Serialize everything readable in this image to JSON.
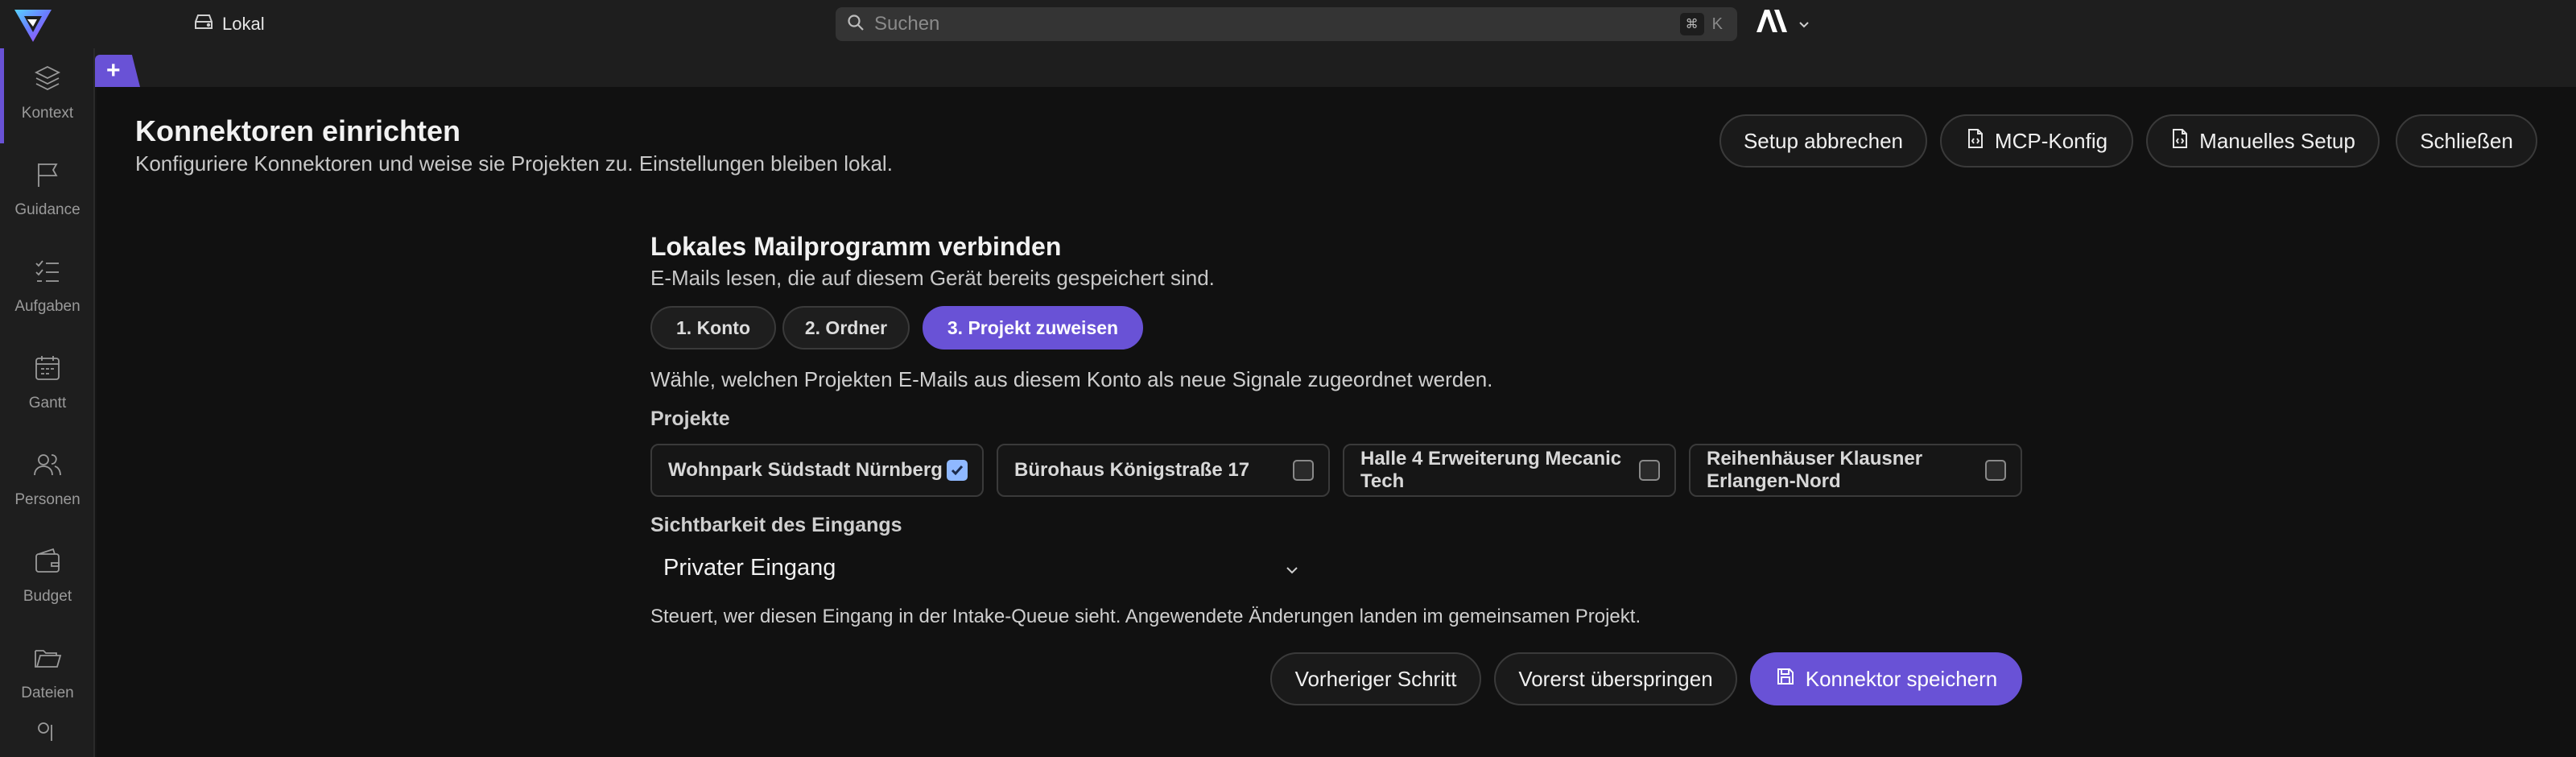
{
  "topbar": {
    "location_label": "Lokal",
    "search_placeholder": "Suchen",
    "shortcut_modifier": "⌘",
    "shortcut_key": "K",
    "brand_mark": "AI"
  },
  "tabs": {
    "add_label": "+"
  },
  "sidebar": {
    "items": [
      {
        "label": "Kontext",
        "icon": "layers-icon"
      },
      {
        "label": "Guidance",
        "icon": "flag-icon"
      },
      {
        "label": "Aufgaben",
        "icon": "checklist-icon"
      },
      {
        "label": "Gantt",
        "icon": "calendar-icon"
      },
      {
        "label": "Personen",
        "icon": "people-icon"
      },
      {
        "label": "Budget",
        "icon": "wallet-icon"
      },
      {
        "label": "Dateien",
        "icon": "folder-icon"
      }
    ]
  },
  "header": {
    "title": "Konnektoren einrichten",
    "subtitle": "Konfiguriere Konnektoren und weise sie Projekten zu. Einstellungen bleiben lokal.",
    "buttons": {
      "cancel": "Setup abbrechen",
      "mcp": "MCP-Konfig",
      "manual": "Manuelles Setup",
      "close": "Schließen"
    }
  },
  "connector": {
    "title": "Lokales Mailprogramm verbinden",
    "subtitle": "E-Mails lesen, die auf diesem Gerät bereits gespeichert sind.",
    "steps": [
      "1. Konto",
      "2. Ordner",
      "3. Projekt zuweisen"
    ],
    "active_step": 3,
    "instruction": "Wähle, welchen Projekten E-Mails aus diesem Konto als neue Signale zugeordnet werden.",
    "projects_label": "Projekte",
    "projects": [
      {
        "name": "Wohnpark Südstadt Nürnberg",
        "checked": true
      },
      {
        "name": "Bürohaus Königstraße 17",
        "checked": false
      },
      {
        "name": "Halle 4 Erweiterung Mecanic Tech",
        "checked": false
      },
      {
        "name": "Reihenhäuser Klausner Erlangen-Nord",
        "checked": false
      }
    ],
    "visibility_label": "Sichtbarkeit des Eingangs",
    "visibility_value": "Privater Eingang",
    "help_text": "Steuert, wer diesen Eingang in der Intake-Queue sieht. Angewendete Änderungen landen im gemeinsamen Projekt.",
    "actions": {
      "previous": "Vorheriger Schritt",
      "skip": "Vorerst überspringen",
      "save": "Konnektor speichern"
    }
  },
  "colors": {
    "accent": "#6952d6",
    "checkbox_checked": "#8fb8ff"
  }
}
